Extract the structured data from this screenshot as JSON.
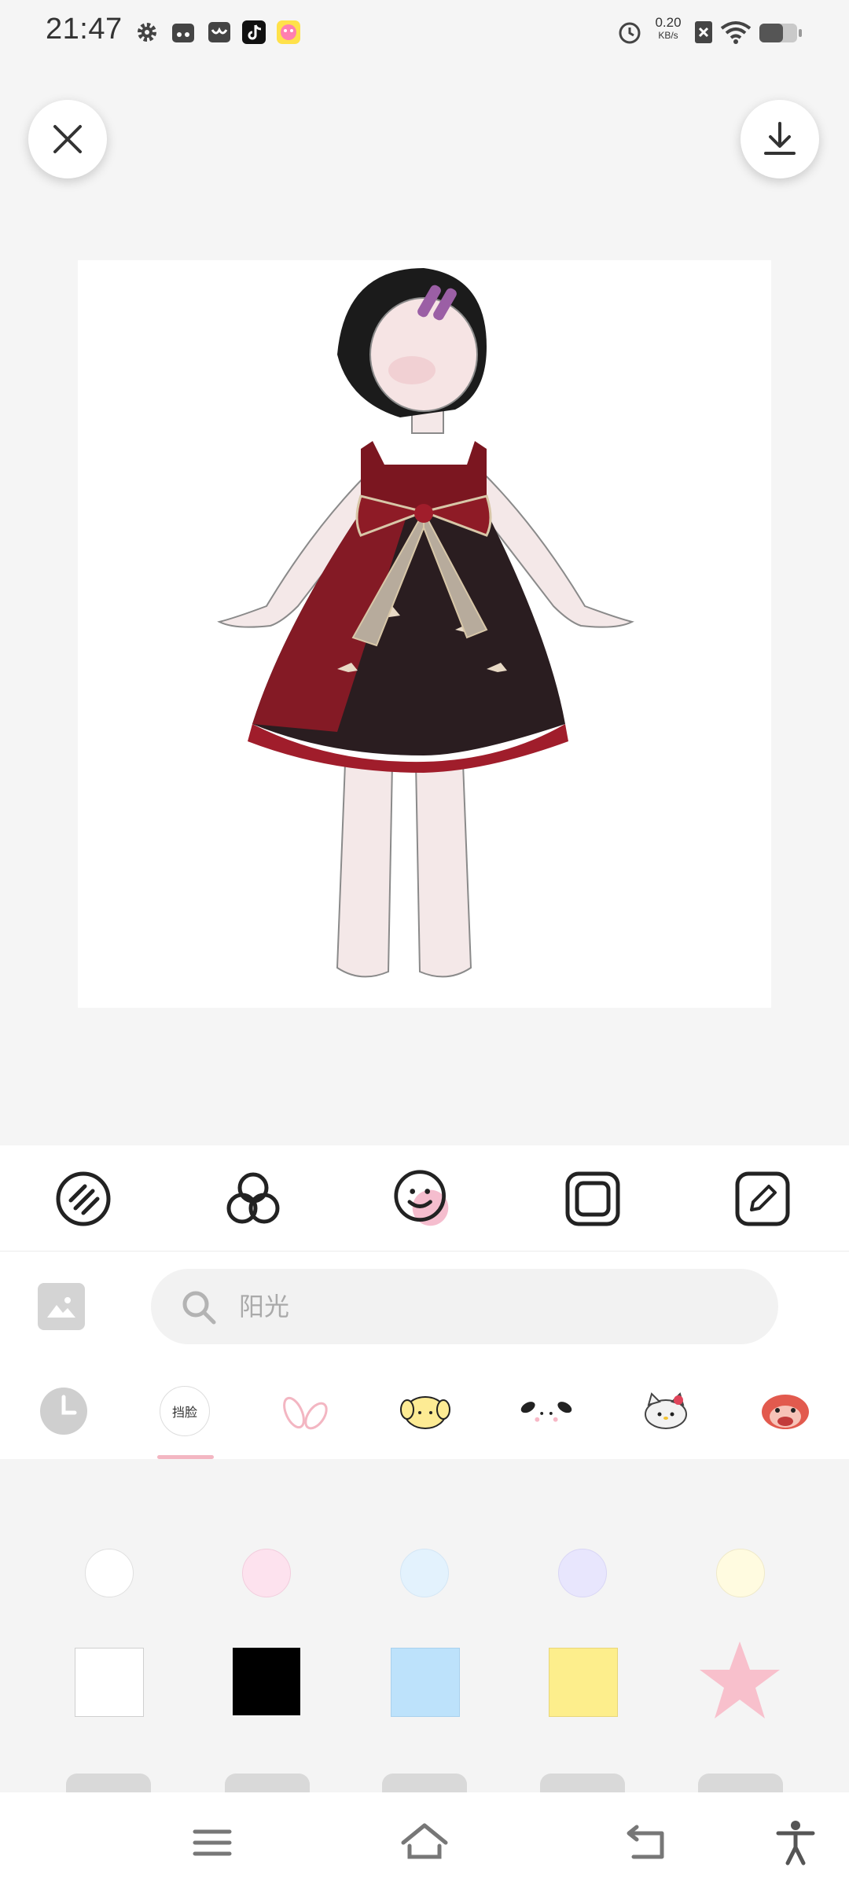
{
  "status_bar": {
    "time": "21:47",
    "icons": [
      "gear-icon",
      "app-icon",
      "message-icon",
      "tiktok-icon",
      "game-icon"
    ],
    "net_speed_value": "0.20",
    "net_speed_unit": "KB/s",
    "right_icons": [
      "alarm-icon",
      "no-sim-icon",
      "wifi-icon",
      "battery-icon"
    ]
  },
  "header": {
    "close_icon": "close-icon",
    "download_icon": "download-icon"
  },
  "toolbar": {
    "tools": [
      "stripe-pattern-tool",
      "color-blend-tool",
      "sticker-tool",
      "frame-tool",
      "draw-tool"
    ],
    "selected": "sticker-tool",
    "accent": "#f2a7bd"
  },
  "search": {
    "placeholder": "阳光"
  },
  "categories": {
    "items": [
      "recent",
      "挡脸",
      "bunny-ears",
      "pudding-dog",
      "pochacco",
      "hello-kitty",
      "red-character"
    ],
    "active_label": "挡脸"
  },
  "stickers": {
    "dot_colors": [
      "#ffffff",
      "#fde2ee",
      "#e3f2fd",
      "#e8e6fd",
      "#fffbe0"
    ],
    "square_colors": [
      "#ffffff",
      "#000000",
      "#bde2fb",
      "#fdee8c"
    ],
    "star_color": "#f8c0cc"
  },
  "navbar": {
    "icons": [
      "menu-icon",
      "home-icon",
      "back-icon",
      "accessibility-icon"
    ]
  }
}
